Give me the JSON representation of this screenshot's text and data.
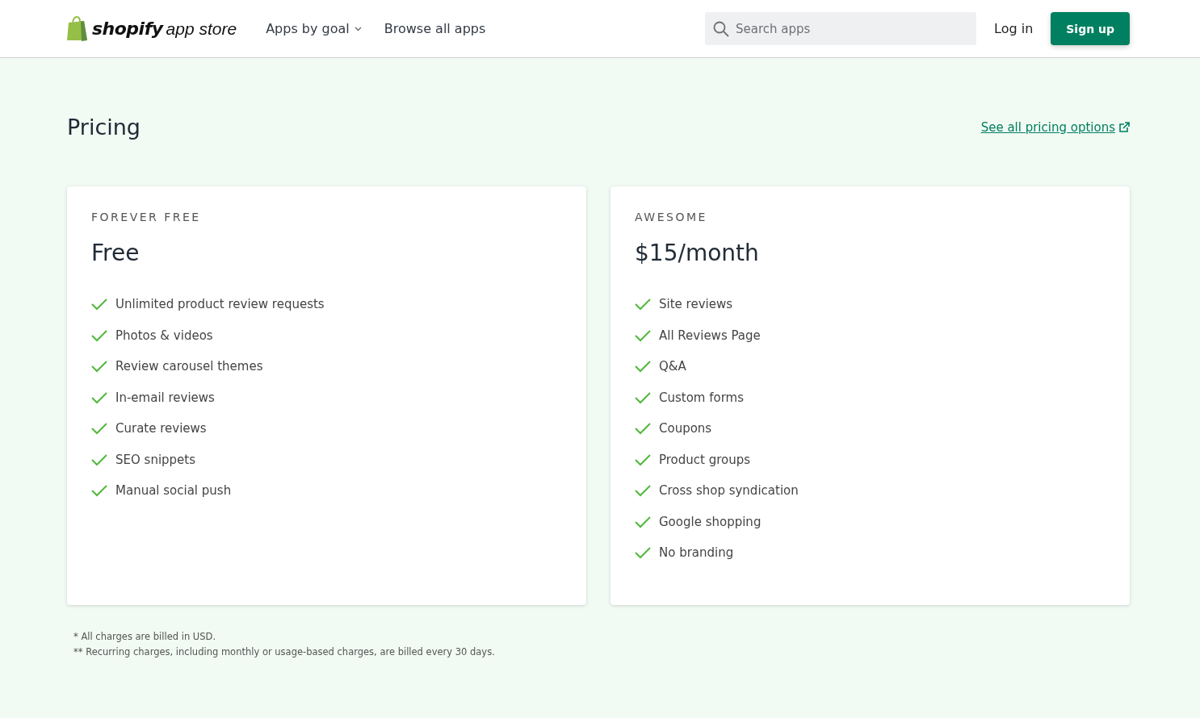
{
  "header": {
    "logo": {
      "brand": "shopify",
      "suffix": "app store"
    },
    "nav": [
      {
        "label": "Apps by goal",
        "kind": "dropdown"
      },
      {
        "label": "Browse all apps",
        "kind": "link"
      }
    ],
    "search": {
      "placeholder": "Search apps"
    },
    "login": "Log in",
    "signup": "Sign up"
  },
  "pricing": {
    "title": "Pricing",
    "link": "See all pricing options",
    "plans": [
      {
        "name": "FOREVER FREE",
        "price": "Free",
        "features": [
          "Unlimited product review requests",
          "Photos & videos",
          "Review carousel themes",
          "In-email reviews",
          "Curate reviews",
          "SEO snippets",
          "Manual social push"
        ]
      },
      {
        "name": "AWESOME",
        "price": "$15/month",
        "features": [
          "Site reviews",
          "All Reviews Page",
          "Q&A",
          "Custom forms",
          "Coupons",
          "Product groups",
          "Cross shop syndication",
          "Google shopping",
          "No branding"
        ]
      }
    ],
    "notes": [
      "* All charges are billed in USD.",
      "** Recurring charges, including monthly or usage-based charges, are billed every 30 days."
    ]
  }
}
